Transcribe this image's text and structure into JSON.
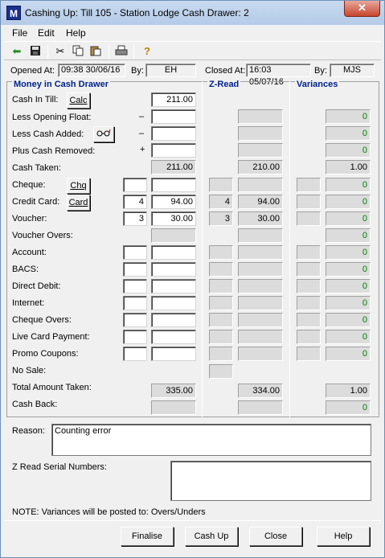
{
  "window": {
    "title": "Cashing Up: Till 105 - Station Lodge  Cash Drawer: 2",
    "close_glyph": "✕",
    "app_icon_text": "M"
  },
  "menu": [
    "File",
    "Edit",
    "Help"
  ],
  "toolbar": [
    "back-arrow-icon",
    "save-icon",
    "cut-icon",
    "copy-icon",
    "paste-icon",
    "print-icon",
    "help-icon"
  ],
  "header": {
    "opened_label": "Opened At:",
    "opened_value": "09:38 30/06/16",
    "by_label": "By:",
    "opened_by": "EH",
    "closed_label": "Closed At:",
    "closed_value": "16:03 05/07/16",
    "closed_by": "MJS"
  },
  "sections": {
    "money": "Money in Cash Drawer",
    "zread": "Z-Read",
    "variances": "Variances"
  },
  "rows": {
    "cash_in_till": {
      "label": "Cash In Till:",
      "button": "Calc",
      "amount": "211.00"
    },
    "less_opening_float": {
      "label": "Less Opening Float:",
      "sign": "–",
      "variance": "0"
    },
    "less_cash_added": {
      "label": "Less Cash Added:",
      "sign": "–",
      "variance": "0"
    },
    "plus_cash_removed": {
      "label": "Plus Cash Removed:",
      "sign": "+",
      "variance": "0"
    },
    "cash_taken": {
      "label": "Cash Taken:",
      "amount": "211.00",
      "zread": "210.00",
      "variance": "1.00"
    },
    "cheque": {
      "label": "Cheque:",
      "button": "Chq",
      "variance": "0"
    },
    "credit_card": {
      "label": "Credit Card:",
      "button": "Card",
      "count": "4",
      "amount": "94.00",
      "z_count": "4",
      "zread": "94.00",
      "variance": "0"
    },
    "voucher": {
      "label": "Voucher:",
      "count": "3",
      "amount": "30.00",
      "z_count": "3",
      "zread": "30.00",
      "variance": "0"
    },
    "voucher_overs": {
      "label": "Voucher Overs:",
      "variance": "0"
    },
    "account": {
      "label": "Account:",
      "variance": "0"
    },
    "bacs": {
      "label": "BACS:",
      "variance": "0"
    },
    "direct_debit": {
      "label": "Direct Debit:",
      "variance": "0"
    },
    "internet": {
      "label": "Internet:",
      "variance": "0"
    },
    "cheque_overs": {
      "label": "Cheque Overs:",
      "variance": "0"
    },
    "live_card": {
      "label": "Live Card Payment:",
      "variance": "0"
    },
    "promo": {
      "label": "Promo Coupons:",
      "variance": "0"
    },
    "no_sale": {
      "label": "No Sale:"
    },
    "total": {
      "label": "Total Amount Taken:",
      "amount": "335.00",
      "zread": "334.00",
      "variance": "1.00"
    },
    "cash_back": {
      "label": "Cash Back:",
      "variance": "0"
    }
  },
  "reason": {
    "label": "Reason:",
    "value": "Counting error"
  },
  "zserial": {
    "label": "Z Read Serial Numbers:",
    "value": ""
  },
  "note": "NOTE: Variances will be posted to: Overs/Unders",
  "footer": {
    "finalise": "Finalise",
    "cashup": "Cash Up",
    "close": "Close",
    "help": "Help"
  }
}
